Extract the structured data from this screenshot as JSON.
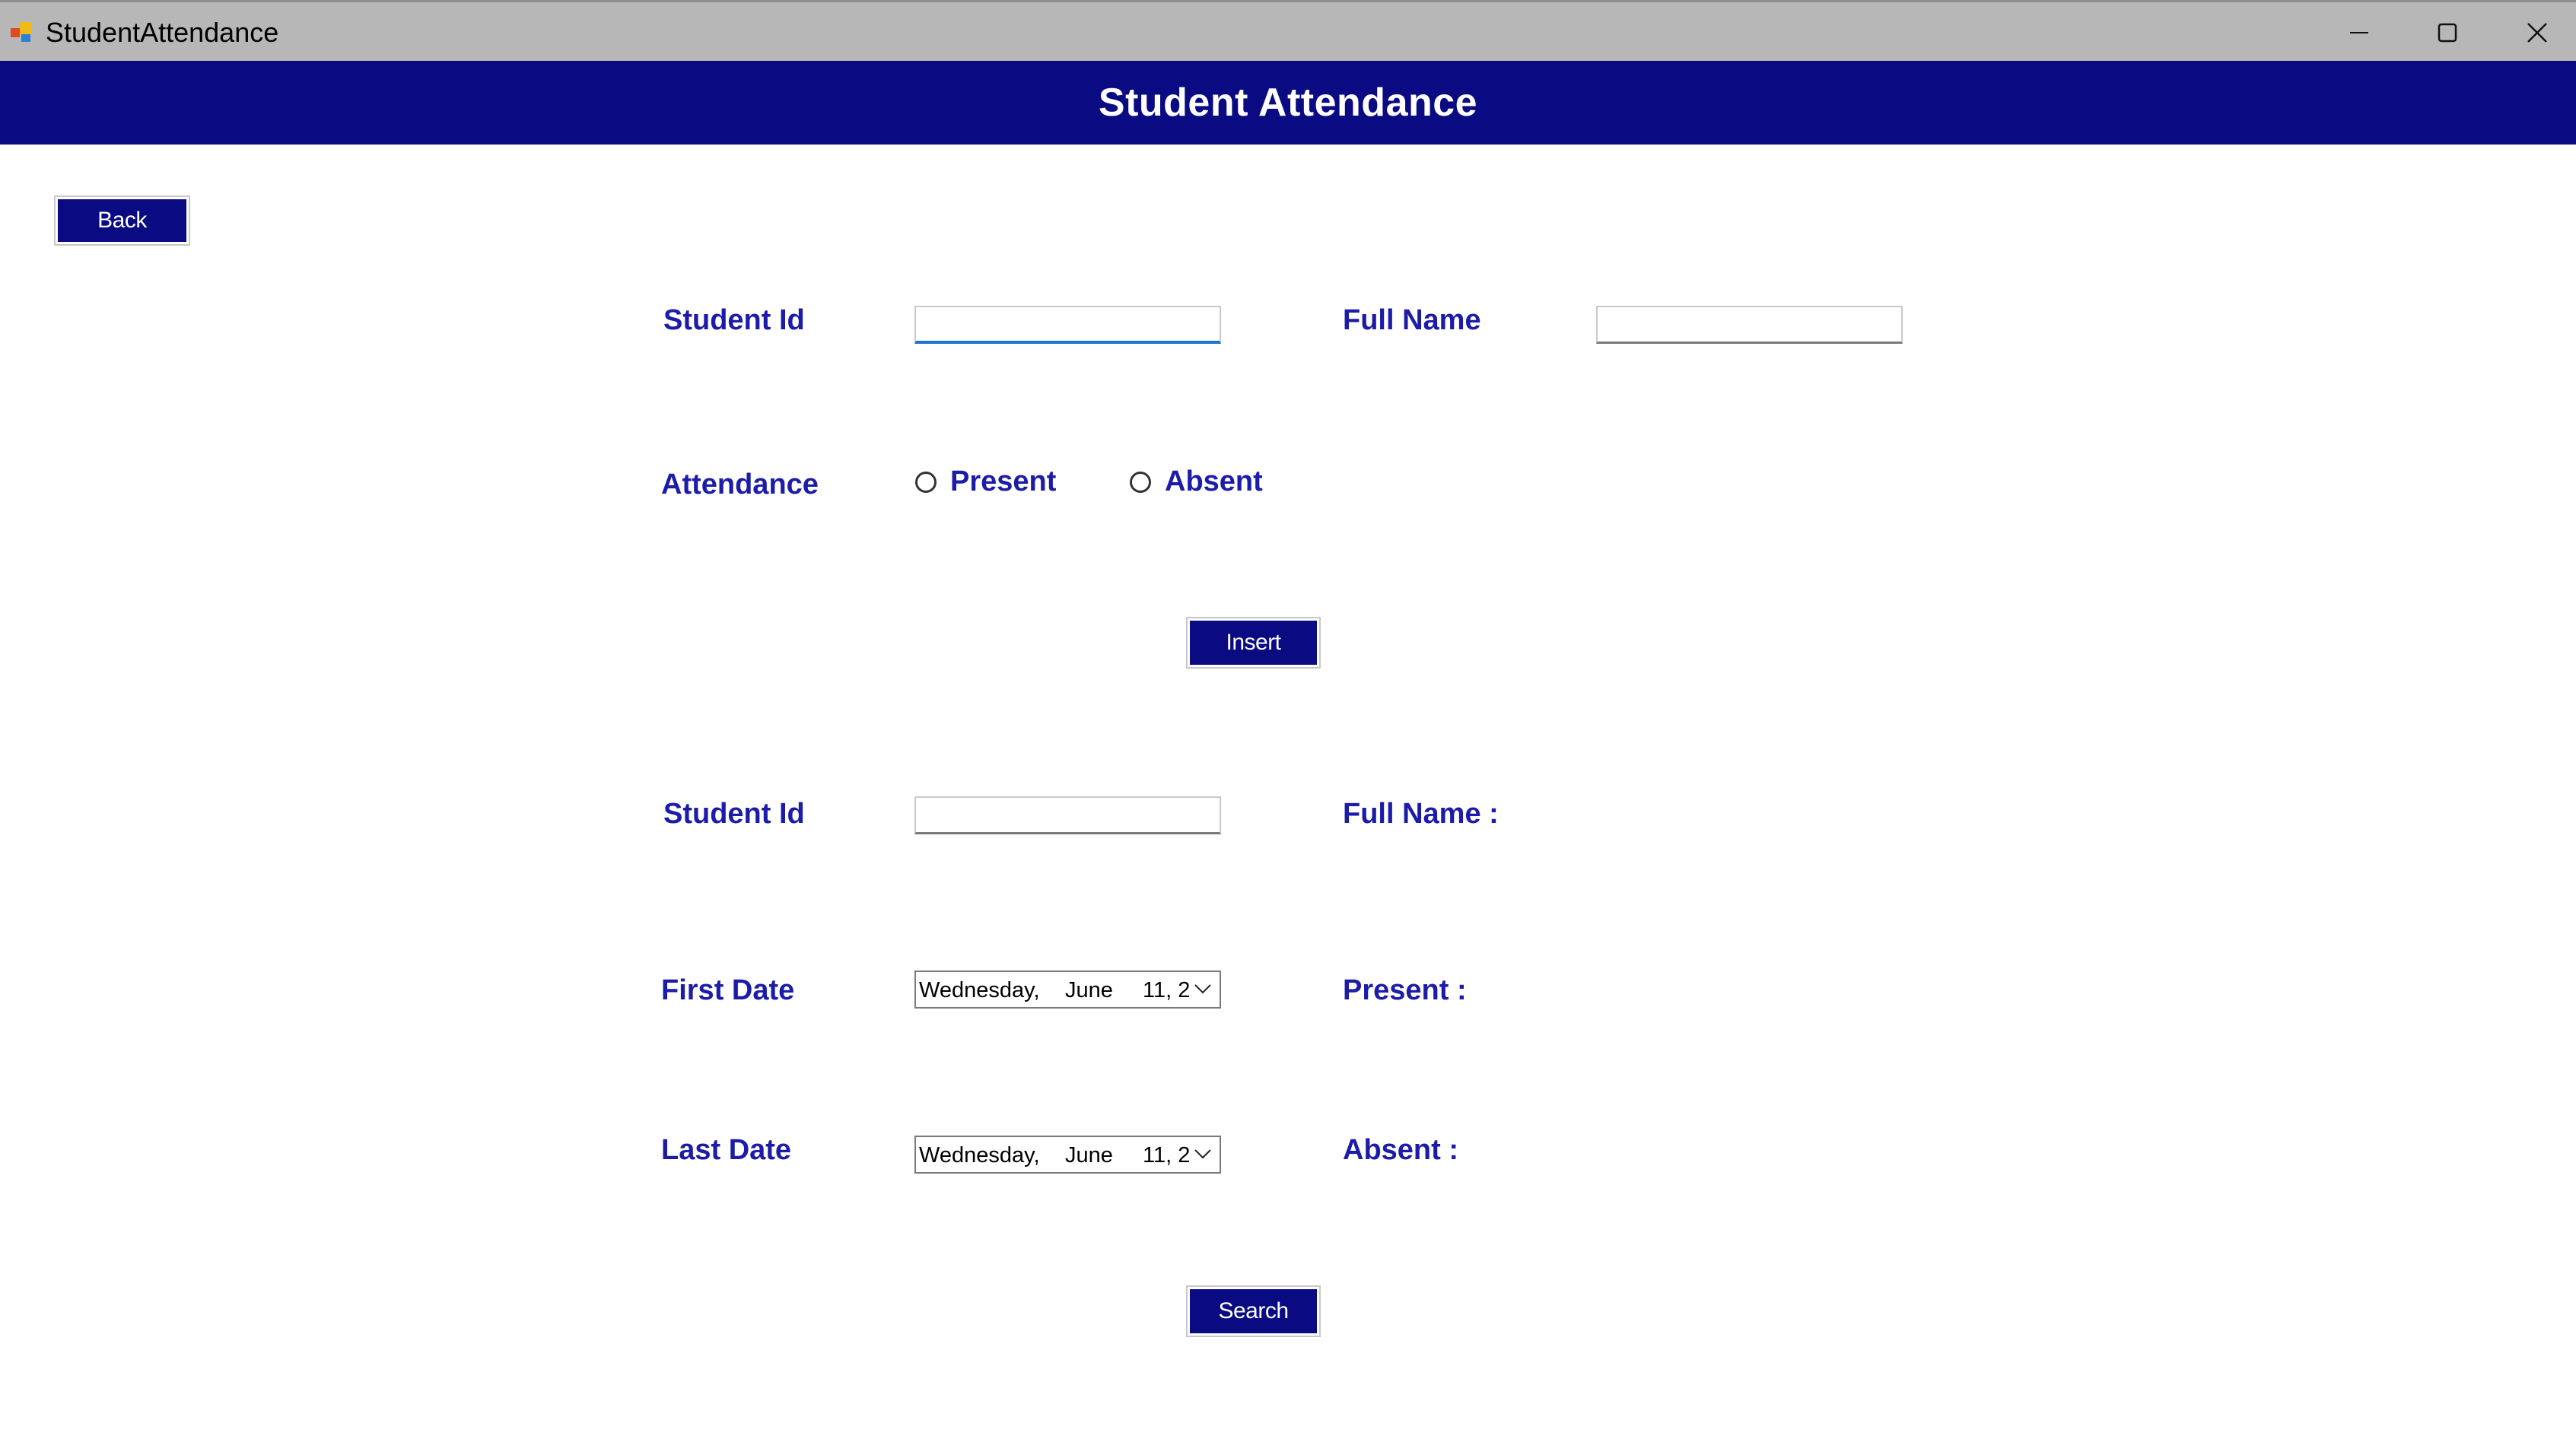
{
  "window": {
    "title": "StudentAttendance",
    "controls": {
      "minimize_icon": "minimize-icon",
      "maximize_icon": "maximize-icon",
      "close_icon": "close-icon"
    }
  },
  "header": {
    "title": "Student Attendance",
    "background": "#0a0a82",
    "text_color": "#ffffff"
  },
  "back_button": {
    "label": "Back"
  },
  "insert_form": {
    "student_id_label": "Student Id",
    "student_id_value": "",
    "full_name_label": "Full Name",
    "full_name_value": "",
    "attendance_label": "Attendance",
    "options": {
      "present": "Present",
      "absent": "Absent"
    },
    "selected_option": null,
    "insert_button": "Insert"
  },
  "search_form": {
    "student_id_label": "Student Id",
    "student_id_value": "",
    "full_name_label": "Full Name :",
    "first_date_label": "First Date",
    "first_date": {
      "day": "Wednesday,",
      "month": "June",
      "rest": "11, 2"
    },
    "last_date_label": "Last Date",
    "last_date": {
      "day": "Wednesday,",
      "month": "June",
      "rest": "11, 2"
    },
    "present_label": "Present :",
    "absent_label": "Absent :",
    "search_button": "Search"
  },
  "colors": {
    "accent": "#0a0a82",
    "label": "#1c1ca8",
    "titlebar": "#b7b7b7",
    "focus": "#1a73d0"
  }
}
